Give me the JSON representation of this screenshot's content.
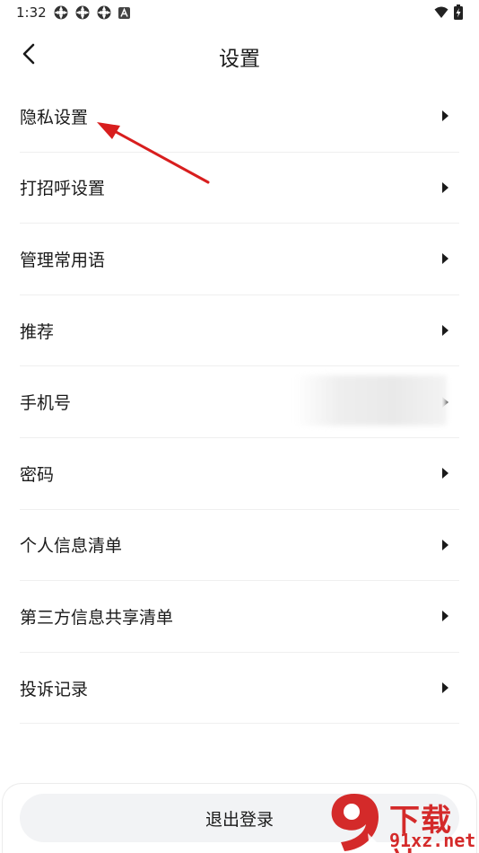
{
  "status_bar": {
    "time": "1:32",
    "notification_icons": [
      "app-notification-icon",
      "app-notification-icon",
      "app-notification-icon",
      "text-a-icon"
    ],
    "right_icons": [
      "wifi-icon",
      "battery-charging-icon"
    ]
  },
  "nav": {
    "title": "设置",
    "back_icon": "chevron-left-icon"
  },
  "settings": {
    "items": [
      {
        "label": "隐私设置"
      },
      {
        "label": "打招呼设置"
      },
      {
        "label": "管理常用语"
      },
      {
        "label": "推荐"
      },
      {
        "label": "手机号"
      },
      {
        "label": "密码"
      },
      {
        "label": "个人信息清单"
      },
      {
        "label": "第三方信息共享清单"
      },
      {
        "label": "投诉记录"
      }
    ]
  },
  "logout": {
    "label": "退出登录"
  },
  "watermark": {
    "text": "下载站",
    "url": "91xz.net"
  },
  "colors": {
    "annotation_arrow": "#d81e1e",
    "logout_bg": "#f2f3f5",
    "divider": "#efefef",
    "watermark": "#d42a2a"
  }
}
